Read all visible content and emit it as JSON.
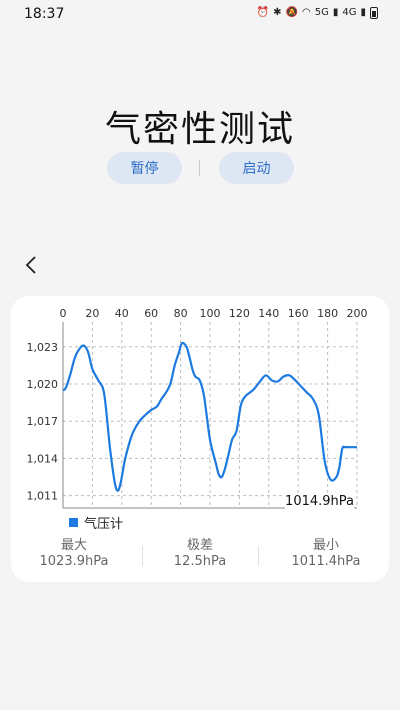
{
  "status_bar": {
    "time": "18:37",
    "icons": [
      "alarm-icon",
      "bluetooth-icon",
      "mute-icon",
      "wifi-icon",
      "signal-5g-icon",
      "signal-4g-icon",
      "battery-icon"
    ],
    "labels": {
      "g5": "5G",
      "g4": "4G"
    }
  },
  "page": {
    "title": "气密性测试"
  },
  "controls": {
    "pause_label": "暂停",
    "start_label": "启动",
    "accent": "#2d6cc8",
    "button_bg": "#dde6f3"
  },
  "chart_data": {
    "type": "line",
    "x_ticks": [
      0,
      20,
      40,
      60,
      80,
      100,
      120,
      140,
      160,
      180,
      200
    ],
    "y_ticks": [
      1011,
      1014,
      1017,
      1020,
      1023
    ],
    "y_tick_labels": [
      "1,011",
      "1,014",
      "1,017",
      "1,020",
      "1,023"
    ],
    "xlim": [
      0,
      200
    ],
    "ylim": [
      1010,
      1025
    ],
    "grid": true,
    "legend_placement": "bottom-left",
    "series": [
      {
        "name": "气压计",
        "color": "#1c7ae0",
        "x": [
          0,
          2,
          5,
          8,
          11,
          14,
          17,
          20,
          24,
          28,
          32,
          35,
          37,
          39,
          42,
          45,
          48,
          52,
          56,
          60,
          64,
          67,
          70,
          73,
          76,
          79,
          81,
          84,
          86,
          88,
          90,
          93,
          96,
          100,
          104,
          106,
          108,
          110,
          112,
          115,
          118,
          121,
          124,
          127,
          130,
          134,
          138,
          142,
          146,
          150,
          154,
          158,
          162,
          166,
          170,
          174,
          178,
          182,
          186,
          188,
          190,
          192,
          195,
          198,
          200
        ],
        "y": [
          1019.5,
          1019.7,
          1020.8,
          1022.1,
          1022.8,
          1023.1,
          1022.6,
          1021.2,
          1020.3,
          1019.2,
          1014.8,
          1012.2,
          1011.4,
          1011.9,
          1013.8,
          1015.2,
          1016.2,
          1017.0,
          1017.5,
          1017.9,
          1018.2,
          1018.8,
          1019.3,
          1020.0,
          1021.5,
          1022.6,
          1023.3,
          1023.0,
          1022.2,
          1021.2,
          1020.6,
          1020.3,
          1019.0,
          1015.5,
          1013.6,
          1012.7,
          1012.5,
          1013.1,
          1014.0,
          1015.5,
          1016.2,
          1018.3,
          1019.0,
          1019.3,
          1019.6,
          1020.2,
          1020.7,
          1020.3,
          1020.2,
          1020.6,
          1020.7,
          1020.3,
          1019.8,
          1019.3,
          1018.8,
          1017.5,
          1013.8,
          1012.3,
          1012.5,
          1013.3,
          1014.8,
          1014.9,
          1014.9,
          1014.9,
          1014.9
        ]
      }
    ]
  },
  "readout": {
    "current": "1014.9hPa"
  },
  "stats": [
    {
      "label": "最大",
      "value": "1023.9hPa"
    },
    {
      "label": "极差",
      "value": "12.5hPa"
    },
    {
      "label": "最小",
      "value": "1011.4hPa"
    }
  ]
}
